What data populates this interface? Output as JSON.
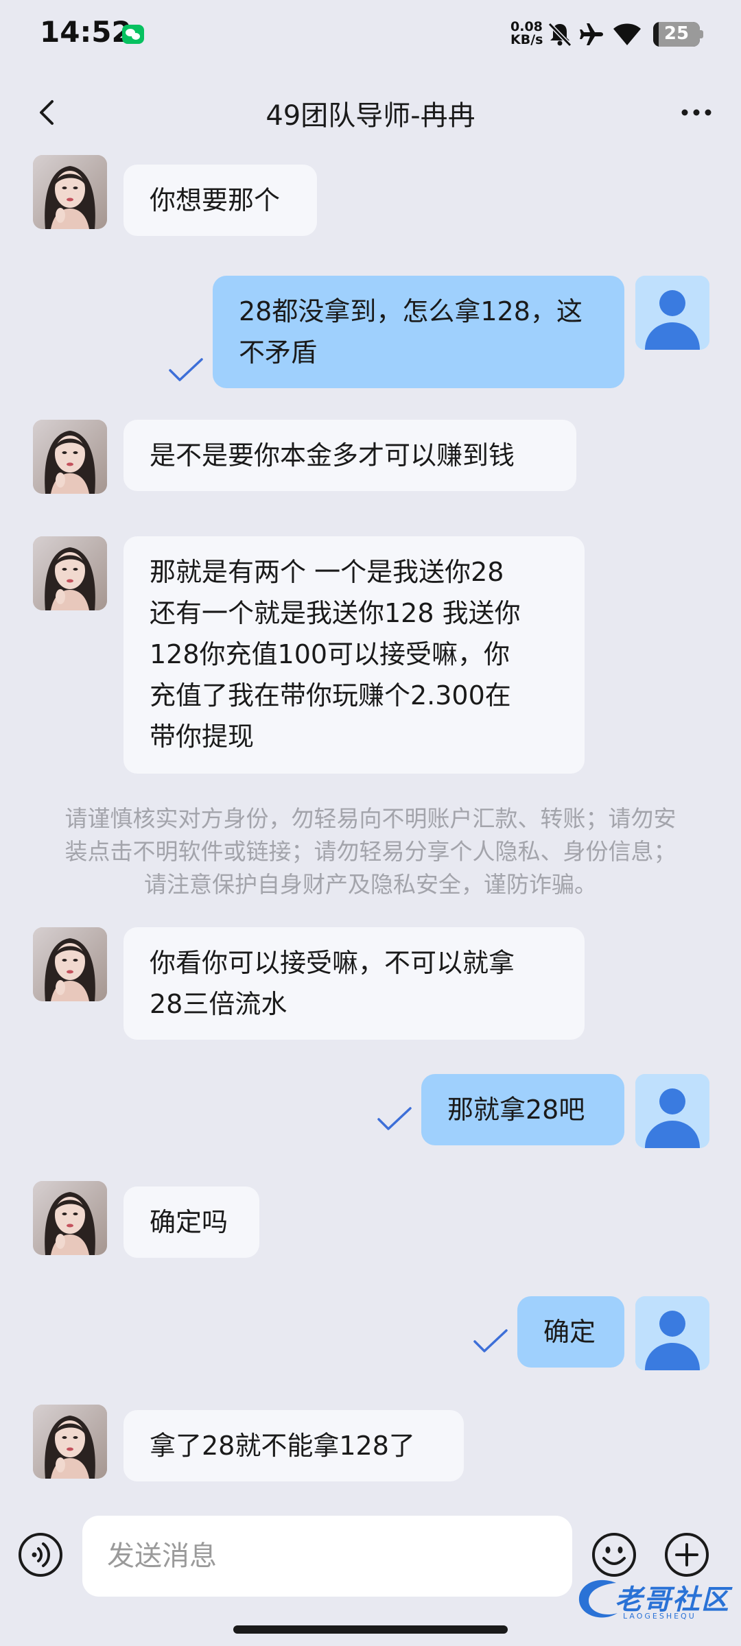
{
  "status_bar": {
    "time": "14:52",
    "net_speed_value": "0.08",
    "net_speed_unit": "KB/s",
    "battery": "25",
    "icons": [
      "wechat-icon",
      "mute-bell-icon",
      "airplane-icon",
      "wifi-icon",
      "battery-icon"
    ]
  },
  "header": {
    "title": "49团队导师-冉冉",
    "icons": [
      "back-arrow-icon",
      "more-dots-icon"
    ]
  },
  "messages": [
    {
      "from": "other",
      "text": "你想要那个"
    },
    {
      "from": "me",
      "line1": "28都没拿到，怎么拿128，这",
      "line2": "不矛盾",
      "read": true
    },
    {
      "from": "other",
      "text": "是不是要你本金多才可以赚到钱"
    },
    {
      "from": "other",
      "line1": "那就是有两个 一个是我送你28",
      "line2": "还有一个就是我送你128 我送你",
      "line3": "128你充值100可以接受嘛，你",
      "line4": "充值了我在带你玩赚个2.300在",
      "line5": "带你提现"
    },
    {
      "from": "other",
      "line1": "你看你可以接受嘛，不可以就拿",
      "line2": "28三倍流水"
    },
    {
      "from": "me",
      "text": "那就拿28吧",
      "read": true
    },
    {
      "from": "other",
      "text": "确定吗"
    },
    {
      "from": "me",
      "text": "确定",
      "read": true
    },
    {
      "from": "other",
      "text": "拿了28就不能拿128了"
    }
  ],
  "security_notice": {
    "line1": "请谨慎核实对方身份，勿轻易向不明账户汇款、转账；请勿安",
    "line2": "装点击不明软件或链接；请勿轻易分享个人隐私、身份信息；",
    "line3": "请注意保护自身财产及隐私安全，谨防诈骗。"
  },
  "composer": {
    "placeholder": "发送消息",
    "icons": [
      "voice-icon",
      "emoji-icon",
      "plus-icon"
    ]
  },
  "watermark": {
    "text": "老哥社区",
    "sub": "LAOGESHEQU"
  },
  "colors": {
    "background": "#e8e9f1",
    "incoming_bubble": "#f6f7fb",
    "outgoing_bubble": "#9fd0fd",
    "read_check": "#3d6fd8",
    "avatar_me": "#3a7be0"
  }
}
